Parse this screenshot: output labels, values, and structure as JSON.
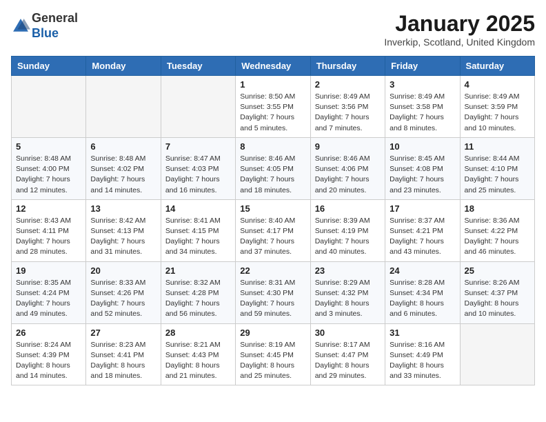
{
  "logo": {
    "general": "General",
    "blue": "Blue"
  },
  "title": "January 2025",
  "location": "Inverkip, Scotland, United Kingdom",
  "days_of_week": [
    "Sunday",
    "Monday",
    "Tuesday",
    "Wednesday",
    "Thursday",
    "Friday",
    "Saturday"
  ],
  "weeks": [
    [
      {
        "day": "",
        "info": ""
      },
      {
        "day": "",
        "info": ""
      },
      {
        "day": "",
        "info": ""
      },
      {
        "day": "1",
        "info": "Sunrise: 8:50 AM\nSunset: 3:55 PM\nDaylight: 7 hours\nand 5 minutes."
      },
      {
        "day": "2",
        "info": "Sunrise: 8:49 AM\nSunset: 3:56 PM\nDaylight: 7 hours\nand 7 minutes."
      },
      {
        "day": "3",
        "info": "Sunrise: 8:49 AM\nSunset: 3:58 PM\nDaylight: 7 hours\nand 8 minutes."
      },
      {
        "day": "4",
        "info": "Sunrise: 8:49 AM\nSunset: 3:59 PM\nDaylight: 7 hours\nand 10 minutes."
      }
    ],
    [
      {
        "day": "5",
        "info": "Sunrise: 8:48 AM\nSunset: 4:00 PM\nDaylight: 7 hours\nand 12 minutes."
      },
      {
        "day": "6",
        "info": "Sunrise: 8:48 AM\nSunset: 4:02 PM\nDaylight: 7 hours\nand 14 minutes."
      },
      {
        "day": "7",
        "info": "Sunrise: 8:47 AM\nSunset: 4:03 PM\nDaylight: 7 hours\nand 16 minutes."
      },
      {
        "day": "8",
        "info": "Sunrise: 8:46 AM\nSunset: 4:05 PM\nDaylight: 7 hours\nand 18 minutes."
      },
      {
        "day": "9",
        "info": "Sunrise: 8:46 AM\nSunset: 4:06 PM\nDaylight: 7 hours\nand 20 minutes."
      },
      {
        "day": "10",
        "info": "Sunrise: 8:45 AM\nSunset: 4:08 PM\nDaylight: 7 hours\nand 23 minutes."
      },
      {
        "day": "11",
        "info": "Sunrise: 8:44 AM\nSunset: 4:10 PM\nDaylight: 7 hours\nand 25 minutes."
      }
    ],
    [
      {
        "day": "12",
        "info": "Sunrise: 8:43 AM\nSunset: 4:11 PM\nDaylight: 7 hours\nand 28 minutes."
      },
      {
        "day": "13",
        "info": "Sunrise: 8:42 AM\nSunset: 4:13 PM\nDaylight: 7 hours\nand 31 minutes."
      },
      {
        "day": "14",
        "info": "Sunrise: 8:41 AM\nSunset: 4:15 PM\nDaylight: 7 hours\nand 34 minutes."
      },
      {
        "day": "15",
        "info": "Sunrise: 8:40 AM\nSunset: 4:17 PM\nDaylight: 7 hours\nand 37 minutes."
      },
      {
        "day": "16",
        "info": "Sunrise: 8:39 AM\nSunset: 4:19 PM\nDaylight: 7 hours\nand 40 minutes."
      },
      {
        "day": "17",
        "info": "Sunrise: 8:37 AM\nSunset: 4:21 PM\nDaylight: 7 hours\nand 43 minutes."
      },
      {
        "day": "18",
        "info": "Sunrise: 8:36 AM\nSunset: 4:22 PM\nDaylight: 7 hours\nand 46 minutes."
      }
    ],
    [
      {
        "day": "19",
        "info": "Sunrise: 8:35 AM\nSunset: 4:24 PM\nDaylight: 7 hours\nand 49 minutes."
      },
      {
        "day": "20",
        "info": "Sunrise: 8:33 AM\nSunset: 4:26 PM\nDaylight: 7 hours\nand 52 minutes."
      },
      {
        "day": "21",
        "info": "Sunrise: 8:32 AM\nSunset: 4:28 PM\nDaylight: 7 hours\nand 56 minutes."
      },
      {
        "day": "22",
        "info": "Sunrise: 8:31 AM\nSunset: 4:30 PM\nDaylight: 7 hours\nand 59 minutes."
      },
      {
        "day": "23",
        "info": "Sunrise: 8:29 AM\nSunset: 4:32 PM\nDaylight: 8 hours\nand 3 minutes."
      },
      {
        "day": "24",
        "info": "Sunrise: 8:28 AM\nSunset: 4:34 PM\nDaylight: 8 hours\nand 6 minutes."
      },
      {
        "day": "25",
        "info": "Sunrise: 8:26 AM\nSunset: 4:37 PM\nDaylight: 8 hours\nand 10 minutes."
      }
    ],
    [
      {
        "day": "26",
        "info": "Sunrise: 8:24 AM\nSunset: 4:39 PM\nDaylight: 8 hours\nand 14 minutes."
      },
      {
        "day": "27",
        "info": "Sunrise: 8:23 AM\nSunset: 4:41 PM\nDaylight: 8 hours\nand 18 minutes."
      },
      {
        "day": "28",
        "info": "Sunrise: 8:21 AM\nSunset: 4:43 PM\nDaylight: 8 hours\nand 21 minutes."
      },
      {
        "day": "29",
        "info": "Sunrise: 8:19 AM\nSunset: 4:45 PM\nDaylight: 8 hours\nand 25 minutes."
      },
      {
        "day": "30",
        "info": "Sunrise: 8:17 AM\nSunset: 4:47 PM\nDaylight: 8 hours\nand 29 minutes."
      },
      {
        "day": "31",
        "info": "Sunrise: 8:16 AM\nSunset: 4:49 PM\nDaylight: 8 hours\nand 33 minutes."
      },
      {
        "day": "",
        "info": ""
      }
    ]
  ]
}
